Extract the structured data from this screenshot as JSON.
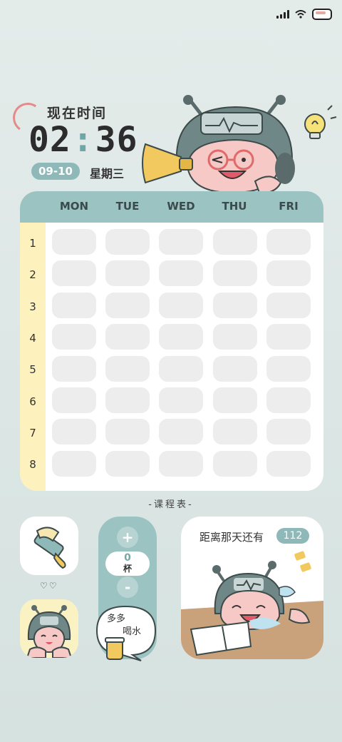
{
  "status_bar": {
    "icons": [
      "signal-icon",
      "wifi-icon",
      "battery-icon"
    ]
  },
  "clock": {
    "label": "现在时间",
    "hours": "02",
    "separator": ":",
    "minutes": "36",
    "date": "09-10",
    "weekday": "星期三"
  },
  "timetable": {
    "days": [
      "MON",
      "TUE",
      "WED",
      "THU",
      "FRI"
    ],
    "periods": [
      "1",
      "2",
      "3",
      "4",
      "5",
      "6",
      "7",
      "8"
    ],
    "caption": "-课程表-"
  },
  "widgets": {
    "hearts": "♡♡",
    "water": {
      "plus": "+",
      "count": "0",
      "unit": "杯",
      "minus": "-",
      "bubble_line1": "多多",
      "bubble_line2": "喝水"
    },
    "countdown": {
      "label": "距离那天还有",
      "days": "112"
    }
  },
  "colors": {
    "accent": "#9bc3c1",
    "period_column": "#fdf1bd",
    "cell": "#ededed",
    "pink": "#e58a8a"
  }
}
